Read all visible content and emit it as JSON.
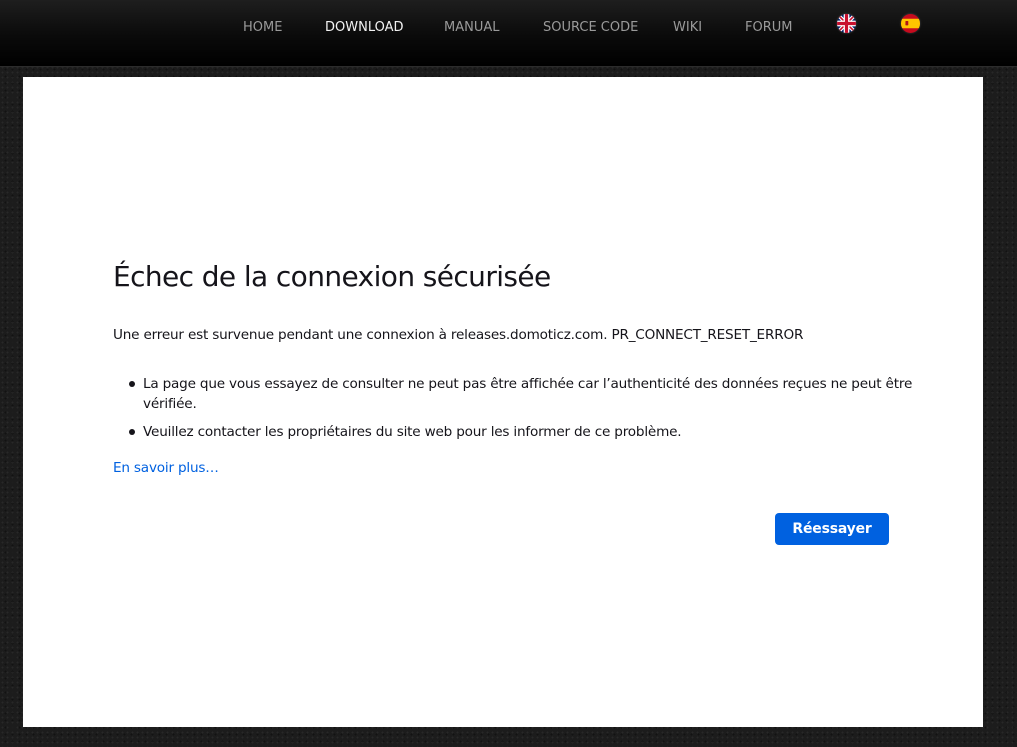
{
  "nav": {
    "items": [
      {
        "label": "HOME",
        "active": false
      },
      {
        "label": "DOWNLOAD",
        "active": true
      },
      {
        "label": "MANUAL",
        "active": false
      },
      {
        "label": "SOURCE CODE",
        "active": false
      },
      {
        "label": "WIKI",
        "active": false
      },
      {
        "label": "FORUM",
        "active": false
      }
    ],
    "languages": [
      {
        "icon": "uk-flag-icon"
      },
      {
        "icon": "spain-flag-icon"
      }
    ]
  },
  "error": {
    "title": "Échec de la connexion sécurisée",
    "description": "Une erreur est survenue pendant une connexion à releases.domoticz.com. PR_CONNECT_RESET_ERROR",
    "bullets": [
      "La page que vous essayez de consulter ne peut pas être affichée car l’authenticité des données reçues ne peut être vérifiée.",
      "Veuillez contacter les propriétaires du site web pour les informer de ce problème."
    ],
    "learn_more": "En savoir plus…",
    "retry_label": "Réessayer"
  },
  "colors": {
    "accent": "#0061e0",
    "nav_active": "#f2f2f2",
    "nav_inactive": "#9a9a9a",
    "text": "#15141a",
    "panel": "#ffffff",
    "background": "#1c1c1c"
  }
}
